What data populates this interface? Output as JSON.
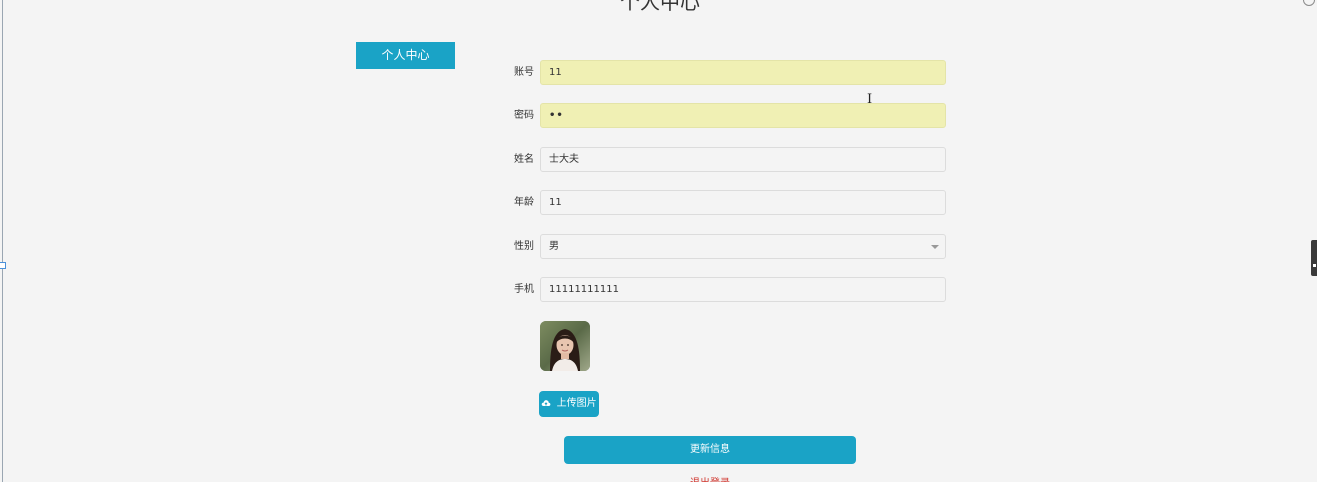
{
  "page": {
    "title": "个人中心"
  },
  "sidebar": {
    "items": [
      {
        "label": "个人中心"
      }
    ]
  },
  "form": {
    "account": {
      "label": "账号",
      "value": "11"
    },
    "password": {
      "label": "密码",
      "value": "••"
    },
    "name": {
      "label": "姓名",
      "value": "士大夫"
    },
    "age": {
      "label": "年龄",
      "value": "11"
    },
    "gender": {
      "label": "性别",
      "value": "男"
    },
    "phone": {
      "label": "手机",
      "value": "11111111111"
    }
  },
  "actions": {
    "upload_label": "上传图片",
    "update_label": "更新信息",
    "logout_label": "退出登录"
  },
  "colors": {
    "accent": "#1aa3c6",
    "autofill_bg": "#f0f0b4",
    "logout": "#d0342c",
    "background": "#f4f4f4"
  },
  "icons": {
    "upload": "cloud-upload-icon",
    "select": "chevron-down-icon"
  }
}
